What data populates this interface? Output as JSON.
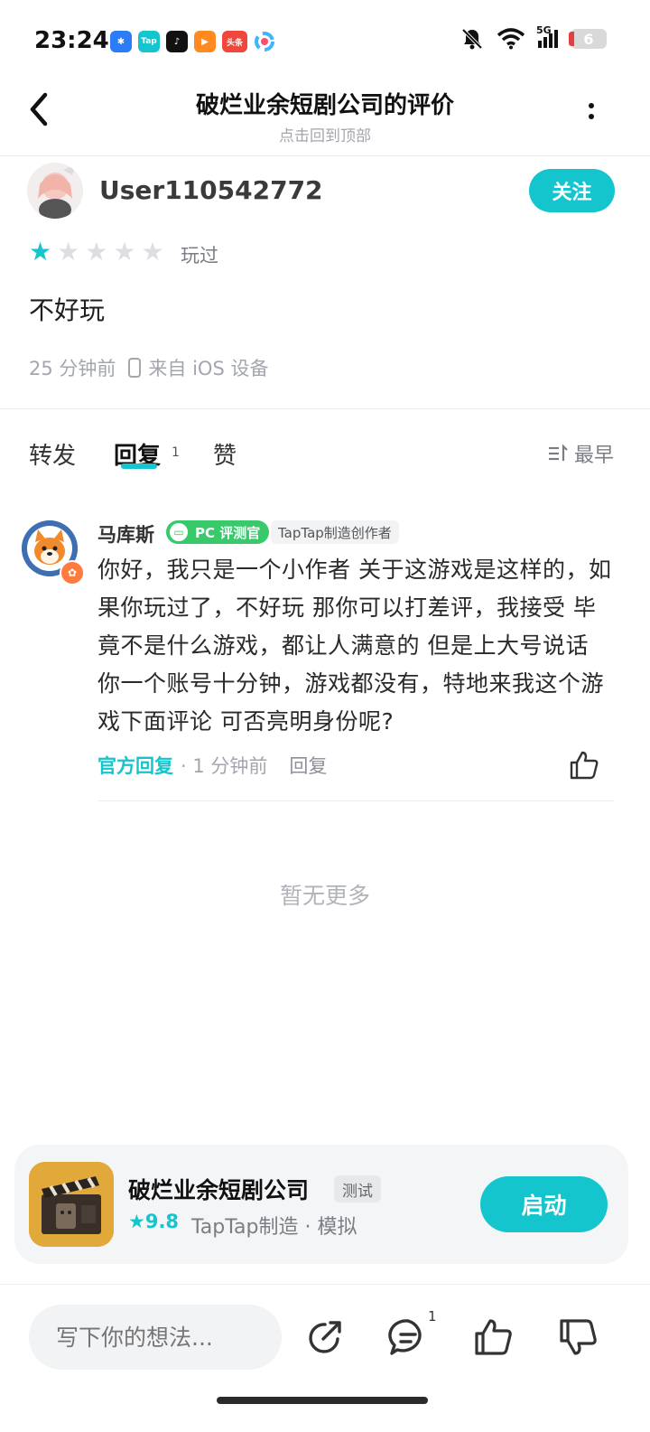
{
  "status_bar": {
    "time": "23:24",
    "apps": [
      "taptap-alt-icon",
      "tap-icon",
      "tiktok-icon",
      "video-icon",
      "toutiao-icon",
      "browser-icon"
    ],
    "network": "5G",
    "battery": "6"
  },
  "nav": {
    "title": "破烂业余短剧公司的评价",
    "subtitle": "点击回到顶部"
  },
  "review": {
    "username": "User110542772",
    "follow_label": "关注",
    "rating": 1,
    "rating_max": 5,
    "played_label": "玩过",
    "text": "不好玩",
    "time": "25 分钟前",
    "device": "来自 iOS 设备"
  },
  "tabs": {
    "forward": "转发",
    "reply": "回复",
    "reply_count": "1",
    "like": "赞",
    "sort": "最早"
  },
  "reply": {
    "name": "马库斯",
    "pc_badge": "PC 评测官",
    "maker_badge": "TapTap制造创作者",
    "text": "你好，我只是一个小作者 关于这游戏是这样的，如果你玩过了，不好玩 那你可以打差评，我接受 毕竟不是什么游戏，都让人满意的 但是上大号说话 你一个账号十分钟，游戏都没有，特地来我这个游戏下面评论 可否亮明身份呢?",
    "official_label": "官方回复",
    "time": "· 1 分钟前",
    "reply_label": "回复"
  },
  "no_more": "暂无更多",
  "game_card": {
    "name": "破烂业余短剧公司",
    "tag": "测试",
    "rating": "9.8",
    "meta": "TapTap制造 · 模拟",
    "launch_label": "启动"
  },
  "bottom_bar": {
    "placeholder": "写下你的想法...",
    "comment_count": "1"
  },
  "colors": {
    "accent": "#15c5ce",
    "badge_green": "#37c96a"
  }
}
